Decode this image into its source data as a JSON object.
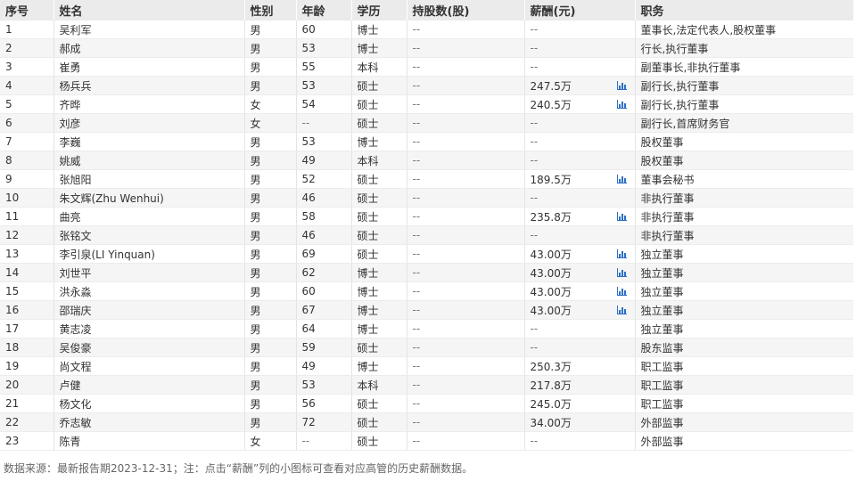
{
  "headers": [
    "序号",
    "姓名",
    "性别",
    "年龄",
    "学历",
    "持股数(股)",
    "薪酬(元)",
    "职务"
  ],
  "rows": [
    {
      "no": "1",
      "name": "吴利军",
      "gender": "男",
      "age": "60",
      "edu": "博士",
      "shares": "--",
      "pay": "--",
      "chart": false,
      "title": "董事长,法定代表人,股权董事"
    },
    {
      "no": "2",
      "name": "郝成",
      "gender": "男",
      "age": "53",
      "edu": "博士",
      "shares": "--",
      "pay": "--",
      "chart": false,
      "title": "行长,执行董事"
    },
    {
      "no": "3",
      "name": "崔勇",
      "gender": "男",
      "age": "55",
      "edu": "本科",
      "shares": "--",
      "pay": "--",
      "chart": false,
      "title": "副董事长,非执行董事"
    },
    {
      "no": "4",
      "name": "杨兵兵",
      "gender": "男",
      "age": "53",
      "edu": "硕士",
      "shares": "--",
      "pay": "247.5万",
      "chart": true,
      "title": "副行长,执行董事"
    },
    {
      "no": "5",
      "name": "齐晔",
      "gender": "女",
      "age": "54",
      "edu": "硕士",
      "shares": "--",
      "pay": "240.5万",
      "chart": true,
      "title": "副行长,执行董事"
    },
    {
      "no": "6",
      "name": "刘彦",
      "gender": "女",
      "age": "--",
      "edu": "硕士",
      "shares": "--",
      "pay": "--",
      "chart": false,
      "title": "副行长,首席财务官"
    },
    {
      "no": "7",
      "name": "李巍",
      "gender": "男",
      "age": "53",
      "edu": "博士",
      "shares": "--",
      "pay": "--",
      "chart": false,
      "title": "股权董事"
    },
    {
      "no": "8",
      "name": "姚威",
      "gender": "男",
      "age": "49",
      "edu": "本科",
      "shares": "--",
      "pay": "--",
      "chart": false,
      "title": "股权董事"
    },
    {
      "no": "9",
      "name": "张旭阳",
      "gender": "男",
      "age": "52",
      "edu": "硕士",
      "shares": "--",
      "pay": "189.5万",
      "chart": true,
      "title": "董事会秘书"
    },
    {
      "no": "10",
      "name": "朱文辉(Zhu Wenhui)",
      "gender": "男",
      "age": "46",
      "edu": "硕士",
      "shares": "--",
      "pay": "--",
      "chart": false,
      "title": "非执行董事"
    },
    {
      "no": "11",
      "name": "曲亮",
      "gender": "男",
      "age": "58",
      "edu": "硕士",
      "shares": "--",
      "pay": "235.8万",
      "chart": true,
      "title": "非执行董事"
    },
    {
      "no": "12",
      "name": "张铭文",
      "gender": "男",
      "age": "46",
      "edu": "硕士",
      "shares": "--",
      "pay": "--",
      "chart": false,
      "title": "非执行董事"
    },
    {
      "no": "13",
      "name": "李引泉(LI Yinquan)",
      "gender": "男",
      "age": "69",
      "edu": "硕士",
      "shares": "--",
      "pay": "43.00万",
      "chart": true,
      "title": "独立董事"
    },
    {
      "no": "14",
      "name": "刘世平",
      "gender": "男",
      "age": "62",
      "edu": "博士",
      "shares": "--",
      "pay": "43.00万",
      "chart": true,
      "title": "独立董事"
    },
    {
      "no": "15",
      "name": "洪永淼",
      "gender": "男",
      "age": "60",
      "edu": "博士",
      "shares": "--",
      "pay": "43.00万",
      "chart": true,
      "title": "独立董事"
    },
    {
      "no": "16",
      "name": "邵瑞庆",
      "gender": "男",
      "age": "67",
      "edu": "博士",
      "shares": "--",
      "pay": "43.00万",
      "chart": true,
      "title": "独立董事"
    },
    {
      "no": "17",
      "name": "黄志凌",
      "gender": "男",
      "age": "64",
      "edu": "博士",
      "shares": "--",
      "pay": "--",
      "chart": false,
      "title": "独立董事"
    },
    {
      "no": "18",
      "name": "吴俊豪",
      "gender": "男",
      "age": "59",
      "edu": "硕士",
      "shares": "--",
      "pay": "--",
      "chart": false,
      "title": "股东监事"
    },
    {
      "no": "19",
      "name": "尚文程",
      "gender": "男",
      "age": "49",
      "edu": "博士",
      "shares": "--",
      "pay": "250.3万",
      "chart": false,
      "title": "职工监事"
    },
    {
      "no": "20",
      "name": "卢健",
      "gender": "男",
      "age": "53",
      "edu": "本科",
      "shares": "--",
      "pay": "217.8万",
      "chart": false,
      "title": "职工监事"
    },
    {
      "no": "21",
      "name": "杨文化",
      "gender": "男",
      "age": "56",
      "edu": "硕士",
      "shares": "--",
      "pay": "245.0万",
      "chart": false,
      "title": "职工监事"
    },
    {
      "no": "22",
      "name": "乔志敏",
      "gender": "男",
      "age": "72",
      "edu": "硕士",
      "shares": "--",
      "pay": "34.00万",
      "chart": false,
      "title": "外部监事"
    },
    {
      "no": "23",
      "name": "陈青",
      "gender": "女",
      "age": "--",
      "edu": "硕士",
      "shares": "--",
      "pay": "--",
      "chart": false,
      "title": "外部监事"
    }
  ],
  "footnote": "数据来源：最新报告期2023-12-31；注：点击“薪酬”列的小图标可查看对应高管的历史薪酬数据。",
  "icons": {
    "salary_chart": "bar-chart-icon"
  },
  "colors": {
    "header_bg": "#ebebeb",
    "alt_row_bg": "#f5f5f5",
    "icon": "#2a6fc9",
    "text": "#333333"
  }
}
